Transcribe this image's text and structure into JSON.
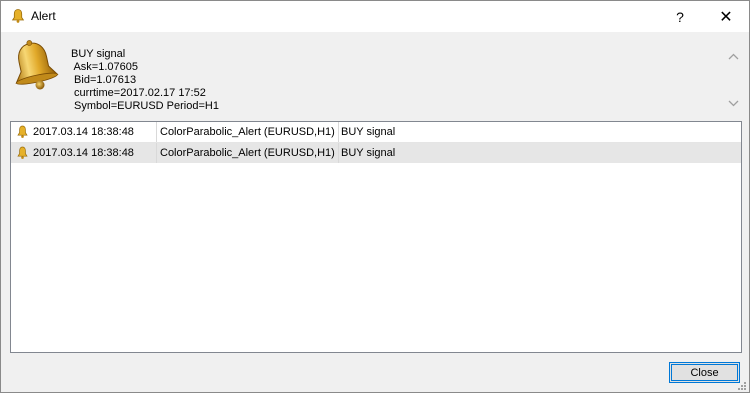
{
  "window": {
    "title": "Alert",
    "title_icon": "bell-icon",
    "help_label": "?",
    "close_label": "✕"
  },
  "message": {
    "icon": "bell-icon",
    "text": "BUY signal\n Ask=1.07605\n Bid=1.07613\n currtime=2017.02.17 17:52\n Symbol=EURUSD Period=H1"
  },
  "alerts": [
    {
      "icon": "bell-icon",
      "time": "2017.03.14 18:38:48",
      "expert": "ColorParabolic_Alert (EURUSD,H1)",
      "message": "BUY signal"
    },
    {
      "icon": "bell-icon",
      "time": "2017.03.14 18:38:48",
      "expert": "ColorParabolic_Alert (EURUSD,H1)",
      "message": "BUY signal"
    }
  ],
  "buttons": {
    "close_label": "Close"
  },
  "colors": {
    "accent": "#0078d7",
    "bell_gold": "#d9a520",
    "selected_row": "#e6e6e6"
  }
}
